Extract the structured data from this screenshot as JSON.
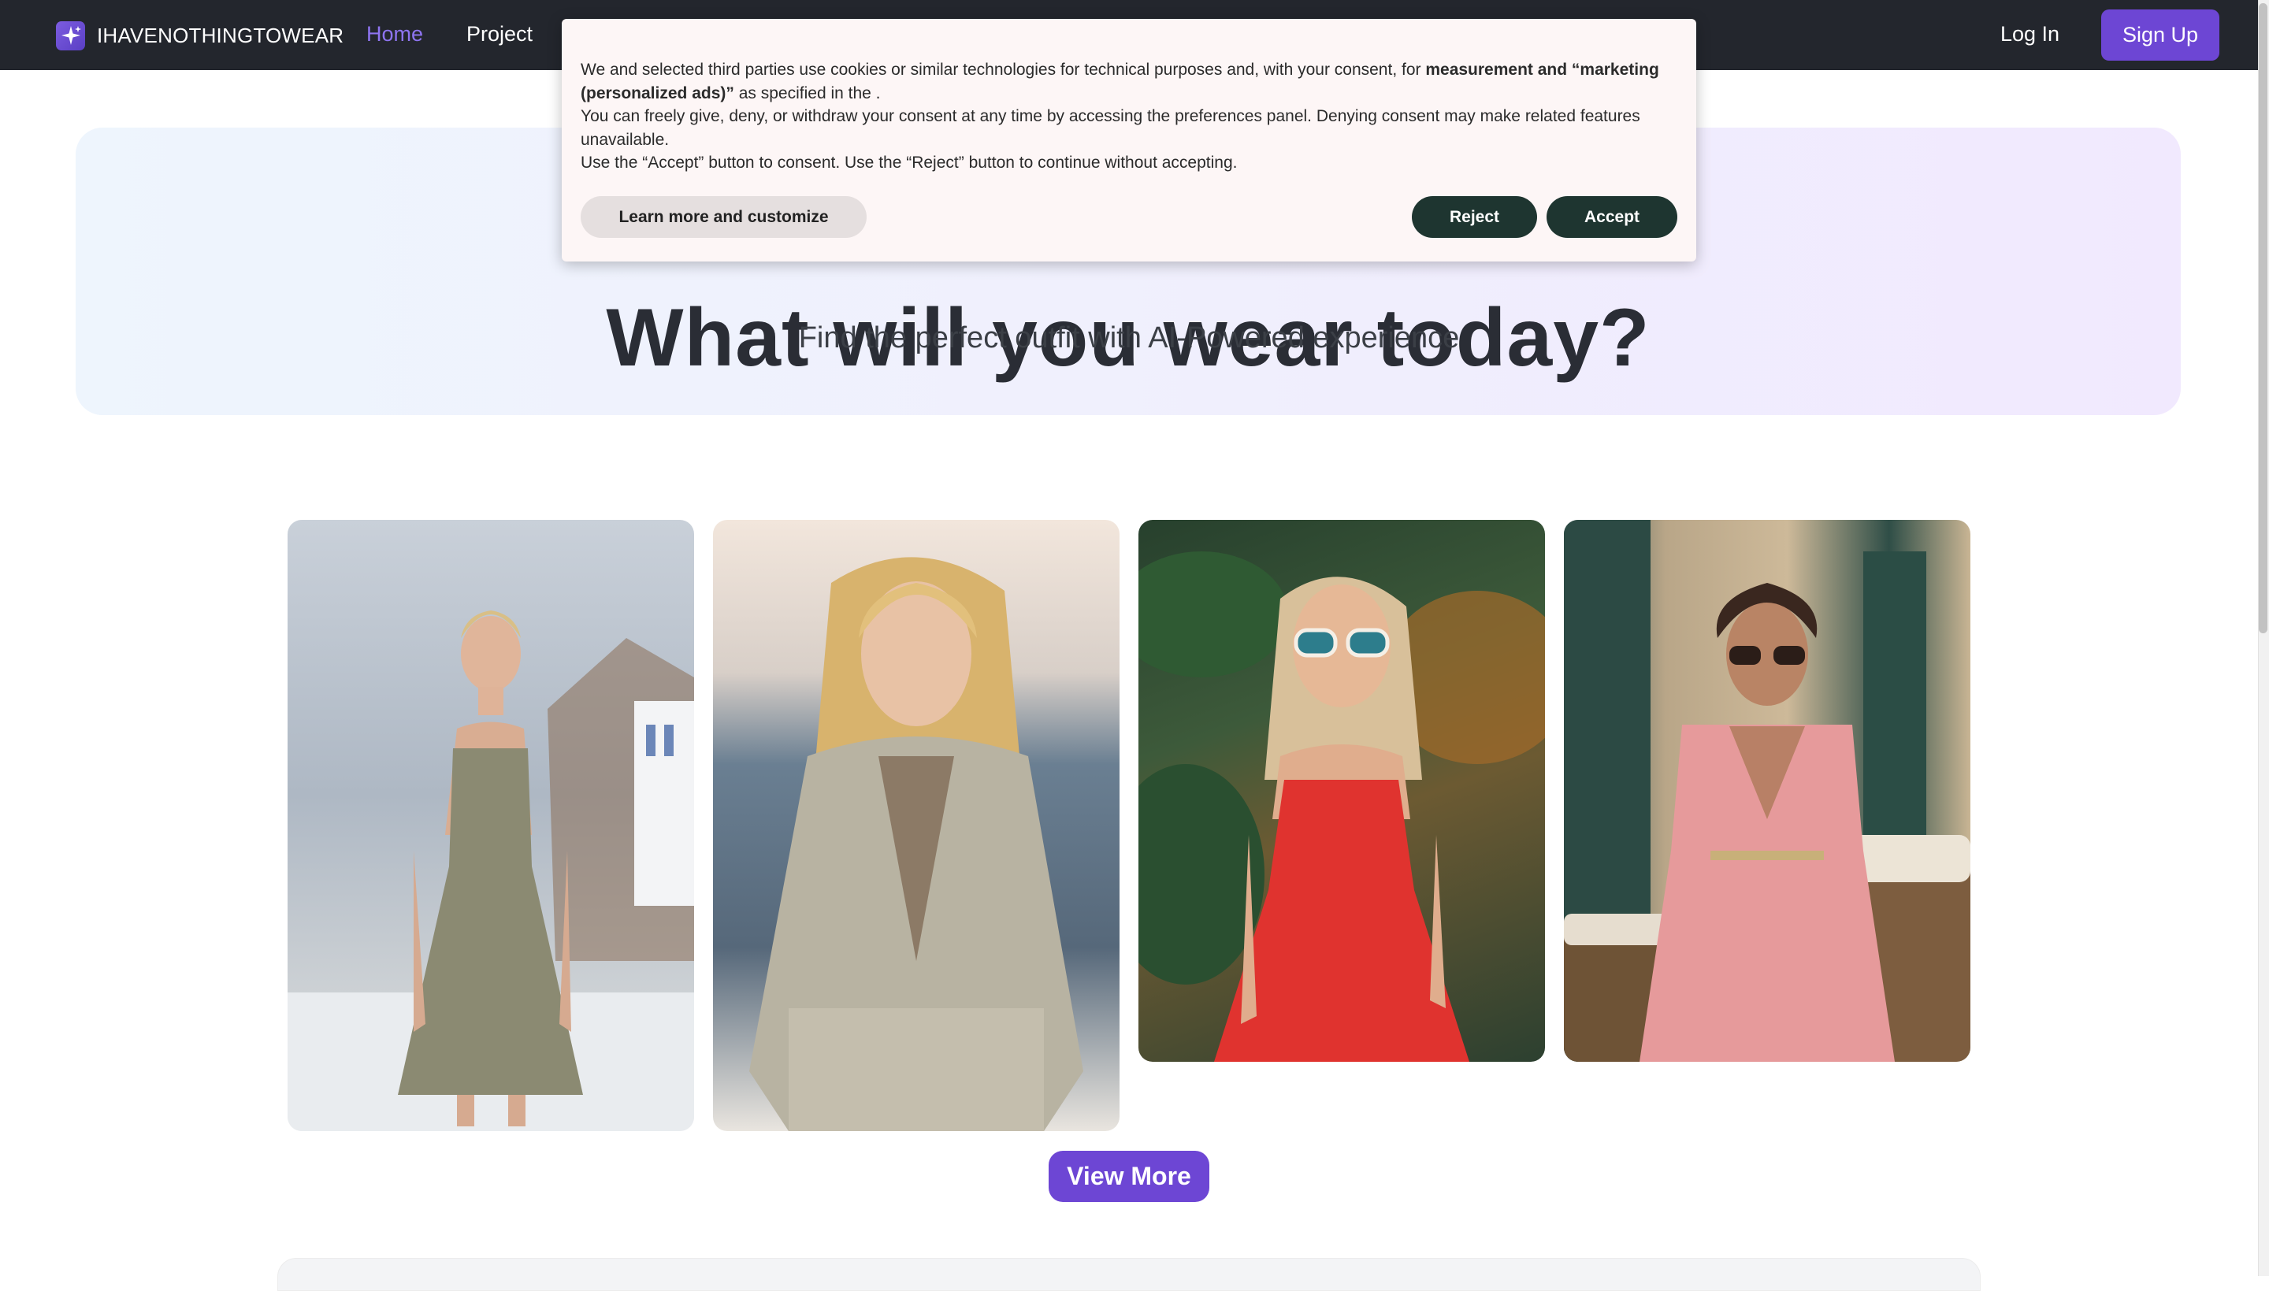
{
  "nav": {
    "brand": "IHAVENOTHINGTOWEAR",
    "links": [
      {
        "label": "Home",
        "active": true
      },
      {
        "label": "Project",
        "active": false
      }
    ],
    "login_label": "Log In",
    "signup_label": "Sign Up",
    "accent_color": "#6d46d4"
  },
  "hero": {
    "title": "What will you wear today?",
    "subtitle": "Find the perfect outfit with AI-Powered experience"
  },
  "cookie": {
    "line1_pre": "We and selected third parties use cookies or similar technologies for technical purposes and, with your consent, for ",
    "line1_bold": "measurement and “marketing (personalized ads)”",
    "line1_post": " as specified in the .",
    "line2": "You can freely give, deny, or withdraw your consent at any time by accessing the preferences panel. Denying consent may make related features unavailable.",
    "line3": "Use the “Accept” button to consent. Use the “Reject” button to continue without accepting.",
    "learn_label": "Learn more and customize",
    "reject_label": "Reject",
    "accept_label": "Accept"
  },
  "gallery": {
    "images": [
      {
        "icon": "woman-floral-slip-dress-image"
      },
      {
        "icon": "woman-boho-tunic-image"
      },
      {
        "icon": "woman-red-sundress-image"
      },
      {
        "icon": "woman-pink-wrap-dress-image"
      }
    ],
    "view_more_label": "View More"
  }
}
